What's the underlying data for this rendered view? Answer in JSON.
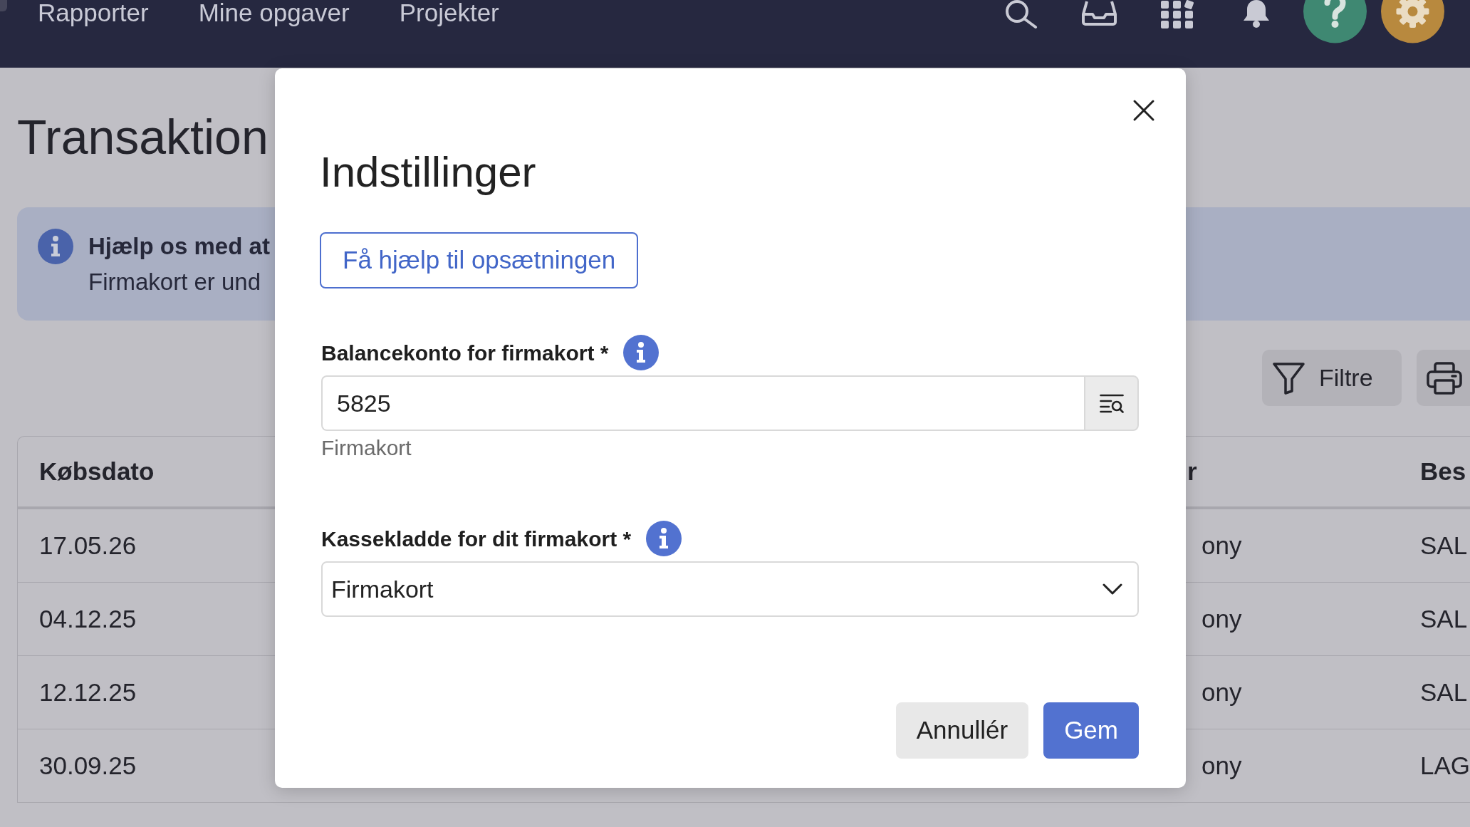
{
  "nav": {
    "items": [
      {
        "label": "Rapporter"
      },
      {
        "label": "Mine opgaver"
      },
      {
        "label": "Projekter"
      }
    ]
  },
  "page_title": "Transaktion",
  "alert": {
    "title": "Hjælp os med at",
    "text": "Firmakort er und"
  },
  "toolbar": {
    "filter_button": "Filtre"
  },
  "table": {
    "columns": [
      "Købsdato",
      "r",
      "Bes"
    ],
    "rows": [
      [
        "17.05.26",
        "ony",
        "SAL"
      ],
      [
        "04.12.25",
        "ony",
        "SAL"
      ],
      [
        "12.12.25",
        "ony",
        "SAL"
      ],
      [
        "30.09.25",
        "ony",
        "LAG"
      ]
    ]
  },
  "dialog": {
    "title": "Indstillinger",
    "help_button": "Få hjælp til opsætningen",
    "fields": [
      {
        "kind": "lookup",
        "label": "Balancekonto for firmakort *",
        "value": "5825",
        "helper": "Firmakort"
      },
      {
        "kind": "select",
        "label": "Kassekladde for dit firmakort *",
        "value": "Firmakort"
      }
    ],
    "buttons": [
      {
        "kind": "secondary",
        "label": "Annullér"
      },
      {
        "kind": "primary",
        "label": "Gem"
      }
    ]
  }
}
